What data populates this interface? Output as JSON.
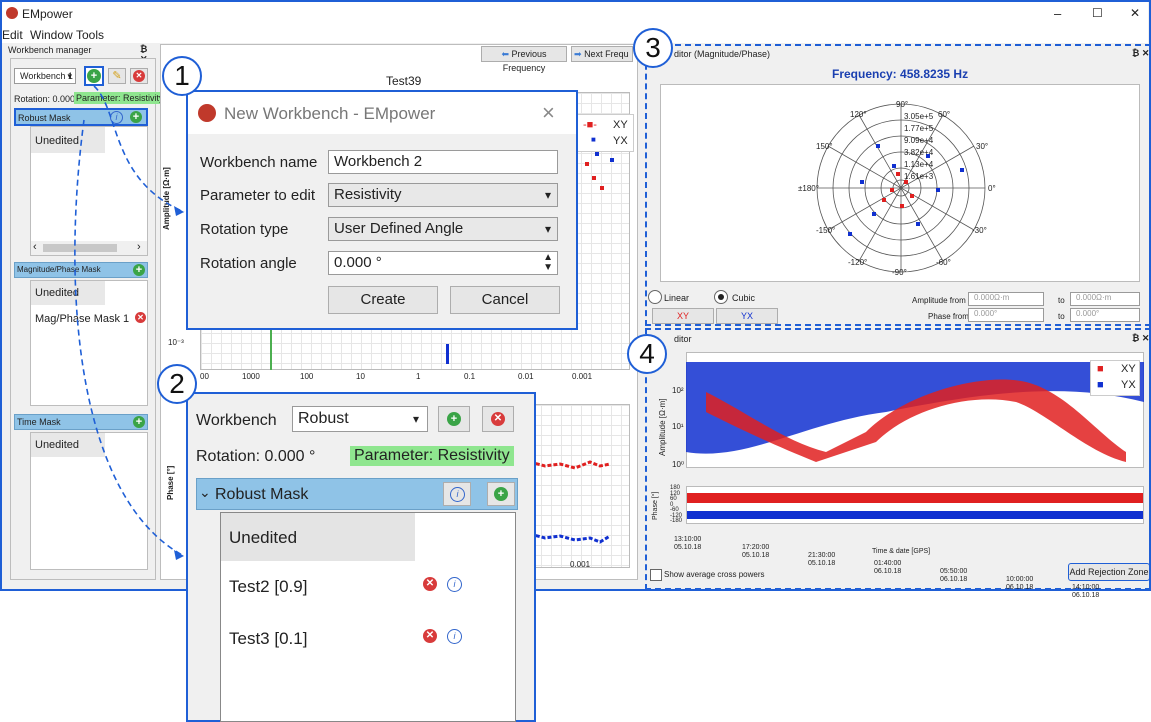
{
  "app": {
    "title": "EMpower",
    "menu": [
      "Edit",
      "Window",
      "Tools"
    ],
    "window_controls": [
      "–",
      "☐",
      "✕"
    ]
  },
  "workbench_manager": {
    "title": "Workbench manager",
    "selected_workbench": "Workbench 1",
    "rotation": "Rotation: 0.000 °",
    "parameter": "Parameter: Resistivity",
    "sections": [
      {
        "title": "Robust Mask",
        "items": [
          "Unedited"
        ]
      },
      {
        "title": "Magnitude/Phase Mask",
        "items": [
          "Unedited",
          "Mag/Phase Mask 1"
        ]
      },
      {
        "title": "Time Mask",
        "items": [
          "Unedited"
        ]
      }
    ]
  },
  "toolbar": {
    "prev_label": "Previous Frequency",
    "next_label": "Next Frequ"
  },
  "center_plot": {
    "title": "Test39",
    "amp_axis": "Amplitude [Ω·m]",
    "phase_axis": "Phase [°]",
    "legend": [
      "XY",
      "YX"
    ],
    "x_ticks": [
      "00",
      "1000",
      "100",
      "10",
      "1",
      "0.1",
      "0.01",
      "0.001"
    ],
    "y_ticks": [
      "10⁻³"
    ],
    "bottom_tick": "0.001"
  },
  "dialog": {
    "title": "New Workbench - EMpower",
    "name_label": "Workbench name",
    "name_value": "Workbench 2",
    "param_label": "Parameter to edit",
    "param_value": "Resistivity",
    "rot_type_label": "Rotation type",
    "rot_type_value": "User Defined Angle",
    "rot_angle_label": "Rotation angle",
    "rot_angle_value": "0.000 °",
    "create": "Create",
    "cancel": "Cancel"
  },
  "zoom_panel": {
    "workbench_label": "Workbench",
    "workbench_value": "Robust",
    "rotation": "Rotation: 0.000 °",
    "parameter": "Parameter: Resistivity",
    "section": "Robust Mask",
    "items": [
      "Unedited",
      "Test2 [0.9]",
      "Test3 [0.1]"
    ]
  },
  "polar_editor": {
    "title": "ditor (Magnitude/Phase)",
    "frequency": "Frequency: 458.8235 Hz",
    "angles": [
      "90°",
      "60°",
      "30°",
      "0°",
      "-30°",
      "-60°",
      "-90°",
      "-120°",
      "-150°",
      "±180°",
      "150°",
      "120°"
    ],
    "radii": [
      "3.05e+5",
      "1.77e+5",
      "9.09e+4",
      "3.82e+4",
      "1.13e+4",
      "1.61e+3"
    ],
    "linear": "Linear",
    "cubic": "Cubic",
    "xy": "XY",
    "yx": "YX",
    "amp_from": "Amplitude from",
    "amp_from_val": "0.000Ω·m",
    "to": "to",
    "amp_to_val": "0.000Ω·m",
    "phase_from": "Phase from",
    "phase_from_val": "0.000°",
    "phase_to_val": "0.000°"
  },
  "time_editor": {
    "title": "ditor",
    "amp_axis": "Amplitude [Ω·m]",
    "phase_axis": "Phase [°]",
    "y_ticks": [
      "10³",
      "10²",
      "10¹",
      "10⁰"
    ],
    "phase_ticks": [
      "180",
      "120",
      "60",
      "0",
      "-60",
      "-120",
      "-180"
    ],
    "legend": [
      "XY",
      "YX"
    ],
    "x_ticks": [
      "13:10:00\n05.10.18",
      "17:20:00\n05.10.18",
      "21:30:00\n05.10.18",
      "01:40:00\n06.10.18",
      "05:50:00\n06.10.18",
      "10:00:00\n06.10.18",
      "14:10:00\n06.10.18"
    ],
    "xlabel": "Time & date [GPS]",
    "show_cross": "Show average cross powers",
    "add_zone": "Add Rejection Zone"
  },
  "callouts": [
    "1",
    "2",
    "3",
    "4"
  ],
  "colors": {
    "accent": "#1f5fd6",
    "xy": "#e02020",
    "yx": "#1030d0",
    "section": "#8fc3e7",
    "param": "#8fe68f"
  }
}
